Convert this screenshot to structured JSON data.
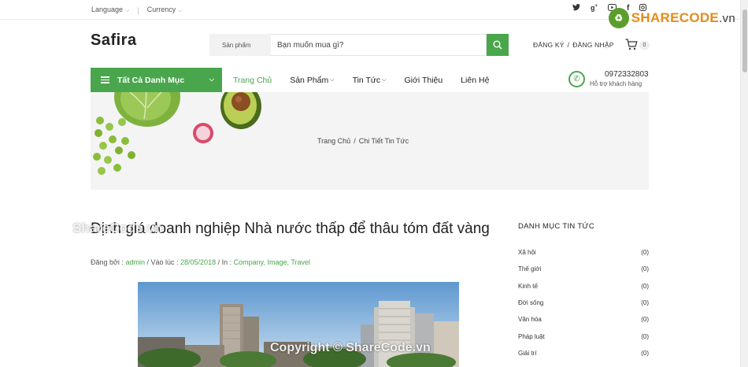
{
  "topbar": {
    "language": "Language",
    "currency": "Currency",
    "socials": [
      "twitter-icon",
      "google-plus-icon",
      "youtube-icon",
      "facebook-icon",
      "instagram-icon"
    ],
    "watermark_brand": "SHARECODE",
    "watermark_tld": ".vn"
  },
  "header": {
    "logo": "Safira",
    "search_category": "Sản phẩm",
    "search_placeholder": "Bạn muốn mua gì?",
    "register": "ĐĂNG KÝ",
    "login": "ĐĂNG NHẬP",
    "cart_count": "0"
  },
  "nav": {
    "all_categories": "Tất Cả Danh Mục",
    "menu": [
      {
        "label": "Trang Chủ",
        "active": true,
        "dropdown": false
      },
      {
        "label": "Sản Phẩm",
        "active": false,
        "dropdown": true
      },
      {
        "label": "Tin Tức",
        "active": false,
        "dropdown": true
      },
      {
        "label": "Giới Thiệu",
        "active": false,
        "dropdown": false
      },
      {
        "label": "Liên Hệ",
        "active": false,
        "dropdown": false
      }
    ],
    "phone": "0972332803",
    "support_text": "Hỗ trợ khách hàng"
  },
  "breadcrumb": {
    "home": "Trang Chủ",
    "separator": "/",
    "current": "Chi Tiết Tin Tức"
  },
  "article": {
    "title": "Định giá doanh nghiệp Nhà nước thấp để thâu tóm đất vàng",
    "posted_by_label": "Đăng bởi :",
    "author": "admin",
    "date_label": "/ Vào lúc :",
    "date": "28/05/2018",
    "in_label": "/ In :",
    "tags": "Company, Image, Travel"
  },
  "sidebar": {
    "title": "DANH MỤC TIN TỨC",
    "items": [
      {
        "label": "Xã hội",
        "count": "(0)"
      },
      {
        "label": "Thế giới",
        "count": "(0)"
      },
      {
        "label": "Kinh tế",
        "count": "(0)"
      },
      {
        "label": "Đời sống",
        "count": "(0)"
      },
      {
        "label": "Văn hóa",
        "count": "(0)"
      },
      {
        "label": "Pháp luật",
        "count": "(0)"
      },
      {
        "label": "Giải trí",
        "count": "(0)"
      }
    ]
  },
  "watermarks": {
    "top": "ShareCode.vn",
    "bottom": "Copyright © ShareCode.vn"
  },
  "colors": {
    "accent": "#49a64c",
    "banner_bg": "#f4f4f4"
  }
}
